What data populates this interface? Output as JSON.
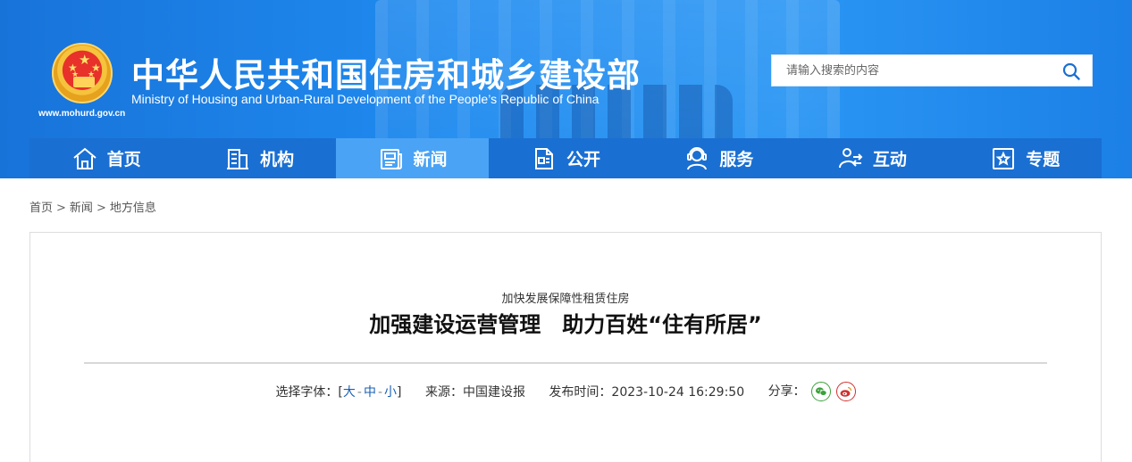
{
  "header": {
    "site_url": "www.mohurd.gov.cn",
    "title": "中华人民共和国住房和城乡建设部",
    "subtitle": "Ministry of Housing and Urban-Rural Development of the People’s Republic of China",
    "search": {
      "placeholder": "请输入搜索的内容",
      "value": ""
    }
  },
  "nav": {
    "items": [
      {
        "label": "首页",
        "icon": "home-icon",
        "active": false
      },
      {
        "label": "机构",
        "icon": "building-icon",
        "active": false
      },
      {
        "label": "新闻",
        "icon": "news-icon",
        "active": true
      },
      {
        "label": "公开",
        "icon": "document-icon",
        "active": false
      },
      {
        "label": "服务",
        "icon": "service-icon",
        "active": false
      },
      {
        "label": "互动",
        "icon": "interaction-icon",
        "active": false
      },
      {
        "label": "专题",
        "icon": "star-topic-icon",
        "active": false
      }
    ]
  },
  "breadcrumb": {
    "items": [
      "首页",
      "新闻",
      "地方信息"
    ],
    "separator": ">"
  },
  "article": {
    "kicker": "加快发展保障性租赁住房",
    "title": "加强建设运营管理　助力百姓“住有所居”",
    "font_size_label": "选择字体：[",
    "font_size_close": "]",
    "font_sizes": [
      "大",
      "中",
      "小"
    ],
    "source_label": "来源：",
    "source": "中国建设报",
    "publish_label": "发布时间：",
    "publish_time": "2023-10-24 16:29:50",
    "share_label": "分享："
  },
  "colors": {
    "header_blue": "#1f8bf0",
    "nav_blue": "#1a6fd2",
    "nav_active": "#4aa3f5",
    "link_blue": "#1a5fb4",
    "wechat_green": "#3aa23a",
    "weibo_red": "#d33030"
  }
}
